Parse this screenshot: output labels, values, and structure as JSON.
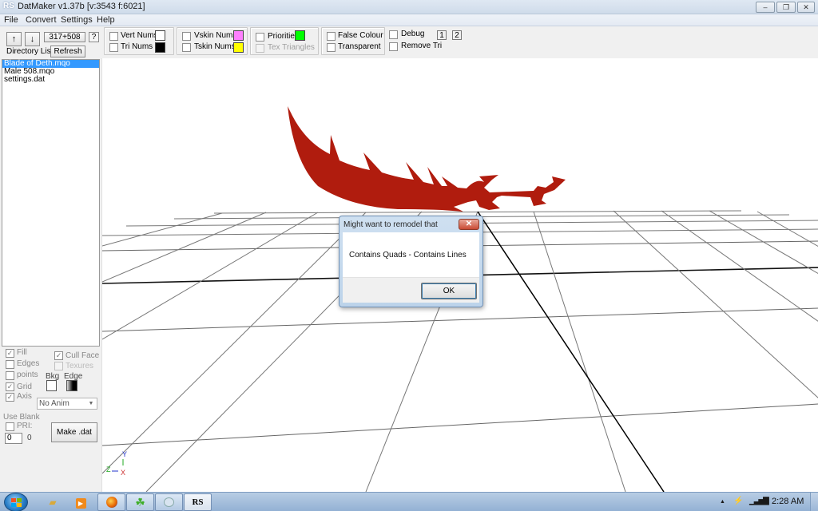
{
  "window": {
    "app_icon": "RS",
    "title": "DatMaker v1.37b  [v:3543 f:6021]",
    "controls": {
      "minimize": "–",
      "maximize": "❐",
      "close": "✕"
    }
  },
  "menu": [
    "File",
    "Convert",
    "Settings",
    "Help"
  ],
  "toolbar": {
    "up_arrow": "↑",
    "down_arrow": "↓",
    "size_button": "317+508",
    "help_button": "?",
    "directory_list_label": "Directory List",
    "refresh_button": "Refresh",
    "groups": {
      "nums": {
        "vert_nums": {
          "label": "Vert Nums",
          "checked": false,
          "color": "#ffffff"
        },
        "tri_nums": {
          "label": "Tri Nums",
          "checked": false,
          "color": "#000000"
        }
      },
      "skin": {
        "vskin_nums": {
          "label": "Vskin Nums",
          "checked": false,
          "color": "#ff80ff"
        },
        "tskin_nums": {
          "label": "Tskin Nums",
          "checked": false,
          "color": "#ffff00"
        }
      },
      "priorities": {
        "priorities": {
          "label": "Priorities",
          "checked": false,
          "color": "#00ff00"
        },
        "tex_triangles": {
          "label": "Tex Triangles",
          "checked": false,
          "disabled": true
        }
      },
      "render": {
        "false_colour": {
          "label": "False Colour",
          "checked": false
        },
        "transparent": {
          "label": "Transparent",
          "checked": false
        }
      }
    },
    "debug": {
      "label": "Debug",
      "checked": false
    },
    "remove_tri": {
      "label": "Remove Tri",
      "checked": false
    },
    "debug_boxes": [
      "1",
      "2"
    ]
  },
  "file_list": {
    "items": [
      "Blade of Deth.mqo",
      "Male 508.mqo",
      "settings.dat"
    ],
    "selected_index": 0
  },
  "view_options": {
    "fill": {
      "label": "Fill",
      "checked": true
    },
    "edges": {
      "label": "Edges",
      "checked": false
    },
    "points": {
      "label": "points",
      "checked": false
    },
    "grid": {
      "label": "Grid",
      "checked": true
    },
    "axis": {
      "label": "Axis",
      "checked": true
    },
    "cull_face": {
      "label": "Cull Face",
      "checked": true
    },
    "textures": {
      "label": "Texures",
      "checked": false,
      "disabled": true
    },
    "bkg_label": "Bkg",
    "edge_label": "Edge",
    "bkg_color": "#ffffff",
    "anim_select": "No Anim",
    "use_blank_label": "Use Blank",
    "pri": {
      "label": "PRI:",
      "checked": false
    },
    "pri_input": "0",
    "pri_value": "0",
    "make_dat_button": "Make .dat"
  },
  "viewport": {
    "model_color": "#b01c0e",
    "axis_labels": {
      "y": "Y",
      "z": "Z",
      "x": "X"
    },
    "axis_colors": {
      "y": "#2233cc",
      "z": "#22aa22",
      "x": "#cc3333"
    }
  },
  "dialog": {
    "title": "Might want to remodel that",
    "message": "Contains Quads - Contains Lines",
    "ok_button": "OK",
    "close_glyph": "✕"
  },
  "taskbar": {
    "pinned": [
      {
        "name": "explorer",
        "glyph": "📁"
      },
      {
        "name": "media-player",
        "glyph": "▶"
      },
      {
        "name": "firefox",
        "glyph": "●"
      },
      {
        "name": "leaf-app",
        "glyph": "☘"
      },
      {
        "name": "paint",
        "glyph": "🎨"
      },
      {
        "name": "rs-app",
        "glyph": "RS"
      }
    ],
    "tray": {
      "show_hidden": "▲",
      "power": "⚡",
      "signal": "▐"
    },
    "clock": "2:28 AM"
  }
}
